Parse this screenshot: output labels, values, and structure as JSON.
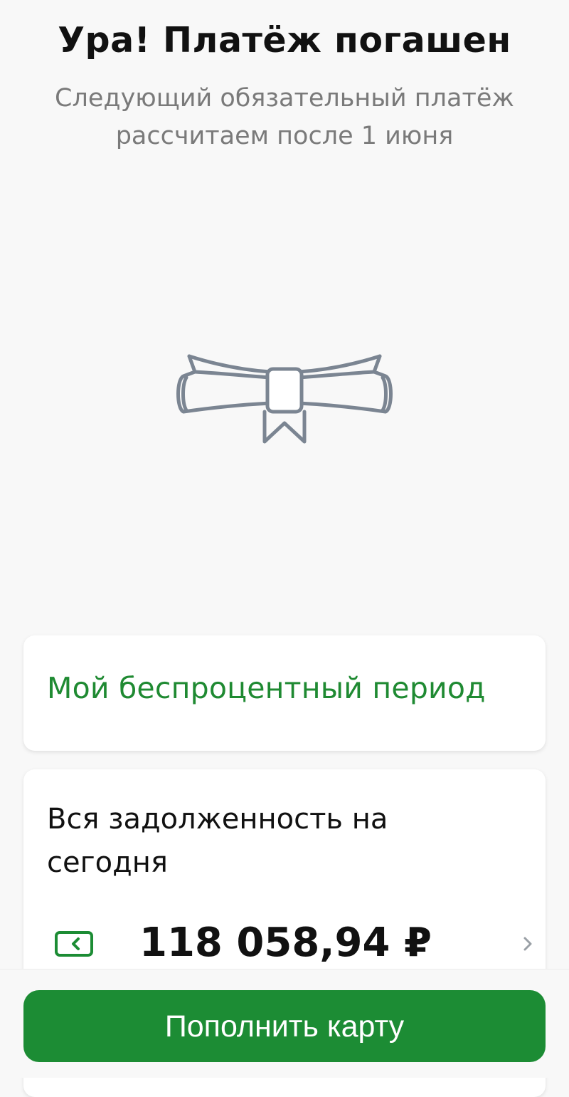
{
  "header": {
    "title": "Ура! Платёж погашен",
    "subtitle_line1": "Следующий обязательный платёж",
    "subtitle_line2": "рассчитаем после 1 июня"
  },
  "illustration": {
    "icon": "diploma-scroll-icon"
  },
  "period_card": {
    "link_label": "Мой беспроцентный период"
  },
  "debt_card": {
    "label_line1": "Вся задолженность на",
    "label_line2": "сегодня",
    "amount": "118 058,94 ₽",
    "card_icon": "bank-card-icon",
    "chevron_icon": "chevron-right-icon"
  },
  "footer": {
    "topup_button_label": "Пополнить карту"
  },
  "colors": {
    "accent_green": "#1c8c34",
    "link_green": "#1f8a32",
    "text_dark": "#111111",
    "text_muted": "#7a7a7a",
    "icon_gray": "#7b8592"
  }
}
